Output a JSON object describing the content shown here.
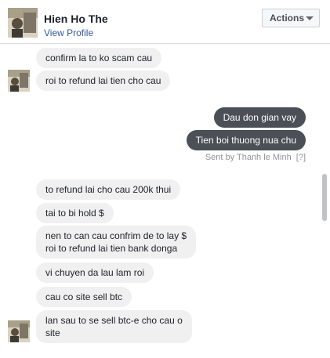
{
  "header": {
    "name": "Hien Ho The",
    "profile_link": "View Profile",
    "actions_label": "Actions"
  },
  "messages": [
    {
      "dir": "in",
      "text": "confirm la to ko scam cau"
    },
    {
      "dir": "in",
      "text": "roi to refund lai tien cho cau"
    },
    {
      "dir": "out",
      "text": "Dau don gian vay"
    },
    {
      "dir": "out",
      "text": "Tien boi thuong nua chu"
    },
    {
      "dir": "in",
      "text": "to refund lai cho cau 200k thui"
    },
    {
      "dir": "in",
      "text": "tai to bi hold $"
    },
    {
      "dir": "in",
      "text": "nen to can cau confrim de to lay $"
    },
    {
      "dir": "in",
      "text": "roi to refund lai tien bank donga"
    },
    {
      "dir": "in",
      "text": "vi chuyen da lau lam roi"
    },
    {
      "dir": "in",
      "text": "cau co site sell btc"
    },
    {
      "dir": "in",
      "text": "lan sau to se sell btc-e cho cau o"
    },
    {
      "dir": "in",
      "text": "site"
    }
  ],
  "seen_status": "Sent by Thanh le Minh",
  "seen_icon_label": "[?]",
  "colors": {
    "incoming_bubble": "#f1f0f0",
    "outgoing_bubble": "#4b4f56",
    "link": "#365899"
  },
  "icons": {
    "actions_dropdown": "chevron-down-icon",
    "avatar": "contact-avatar"
  }
}
